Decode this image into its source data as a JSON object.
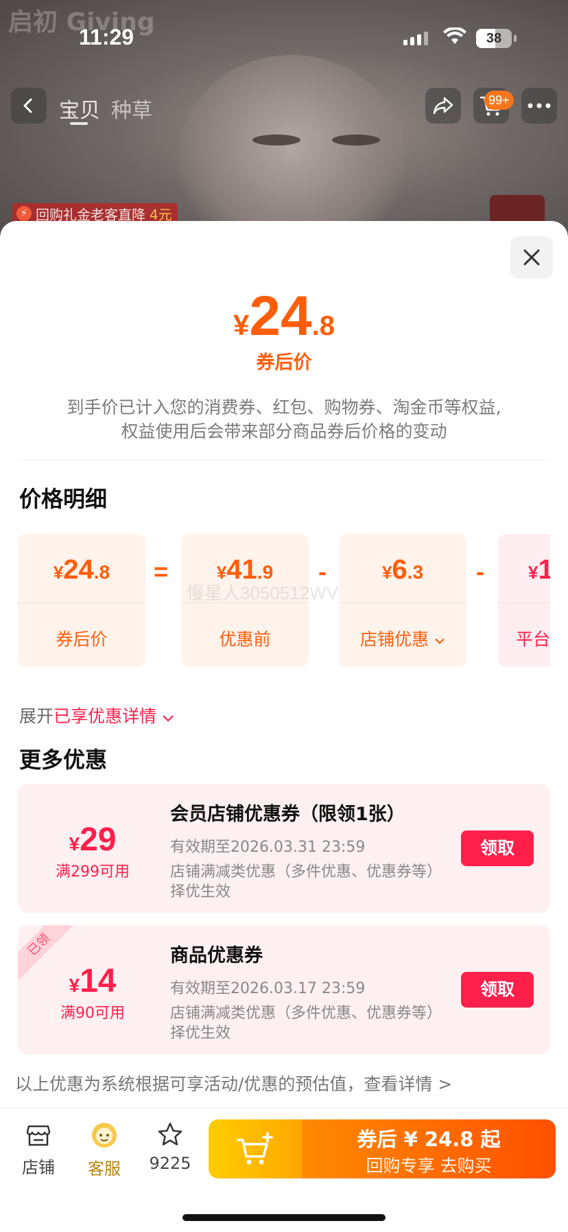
{
  "status_bar": {
    "time": "11:29",
    "battery": "38"
  },
  "background": {
    "watermark": "启初 Giving"
  },
  "nav": {
    "tabs": [
      "宝贝",
      "种草"
    ],
    "cart_badge": "99+"
  },
  "promo_tag": {
    "text": "回购礼金老客直降",
    "amount": "4元"
  },
  "sheet": {
    "price": {
      "currency": "¥",
      "integer": "24",
      "decimal": ".8"
    },
    "price_label": "券后价",
    "note_line1": "到手价已计入您的消费券、红包、购物券、淘金币等权益,",
    "note_line2": "权益使用后会带来部分商品券后价格的变动",
    "breakdown_title": "价格明细",
    "breakdown": [
      {
        "currency": "¥",
        "integer": "24",
        "decimal": ".8",
        "label": "券后价"
      },
      {
        "currency": "¥",
        "integer": "41",
        "decimal": ".9",
        "label": "优惠前"
      },
      {
        "currency": "¥",
        "integer": "6",
        "decimal": ".3",
        "label": "店铺优惠"
      },
      {
        "currency": "¥",
        "integer": "1",
        "decimal": "",
        "label": "平台"
      }
    ],
    "ops": [
      "=",
      "-",
      "-"
    ],
    "watermark_text": "慢星人3050512WV",
    "expand_prefix": "展开",
    "expand_highlight": "已享优惠详情",
    "more_title": "更多优惠",
    "coupons": [
      {
        "currency": "¥",
        "amount": "29",
        "condition": "满299可用",
        "title": "会员店铺优惠券（限领1张）",
        "valid": "有效期至2026.03.31 23:59",
        "desc": "店铺满减类优惠（多件优惠、优惠券等）择优生效",
        "button": "领取",
        "ribbon": ""
      },
      {
        "currency": "¥",
        "amount": "14",
        "condition": "满90可用",
        "title": "商品优惠券",
        "valid": "有效期至2026.03.17 23:59",
        "desc": "店铺满减类优惠（多件优惠、优惠券等）择优生效",
        "button": "领取",
        "ribbon": "已领"
      }
    ],
    "footer_note": "以上优惠为系统根据可享活动/优惠的预估值，查看详情 >"
  },
  "bottom_bar": {
    "store": "店铺",
    "service": "客服",
    "favorites": "9225",
    "buy_line1": "券后 ¥ 24.8 起",
    "buy_line2": "回购专享  去购买"
  },
  "colors": {
    "accent_orange": "#ff5d0a",
    "accent_red": "#ff1f4b"
  }
}
